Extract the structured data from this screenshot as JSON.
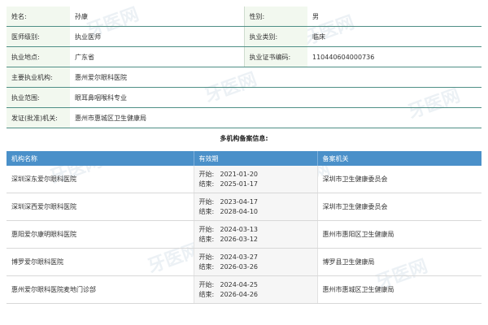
{
  "info": {
    "rows": [
      [
        {
          "label": "姓名:",
          "value": "孙康"
        },
        {
          "label": "性别:",
          "value": "男"
        }
      ],
      [
        {
          "label": "医师级别:",
          "value": "执业医师"
        },
        {
          "label": "执业类别:",
          "value": "临床"
        }
      ],
      [
        {
          "label": "执业地点:",
          "value": "广东省"
        },
        {
          "label": "执业证书编码:",
          "value": "110440604000736"
        }
      ]
    ],
    "wide_rows": [
      {
        "label": "主要执业机构:",
        "value": "惠州爱尔眼科医院"
      },
      {
        "label": "执业范围:",
        "value": "眼耳鼻咽喉科专业"
      },
      {
        "label": "发证(批准)机关:",
        "value": "惠州市惠城区卫生健康局"
      }
    ]
  },
  "section_title": "多机构备案信息:",
  "multi": {
    "headers": [
      "机构名称",
      "有效期",
      "备案机关"
    ],
    "start_label": "开始:",
    "end_label": "结束:",
    "rows": [
      {
        "name": "深圳深东爱尔眼科医院",
        "start": "2021-01-20",
        "end": "2025-01-17",
        "authority": "深圳市卫生健康委员会"
      },
      {
        "name": "深圳深西爱尔眼科医院",
        "start": "2023-04-17",
        "end": "2028-04-10",
        "authority": "深圳市卫生健康委员会"
      },
      {
        "name": "惠阳爱尔康明眼科医院",
        "start": "2024-03-13",
        "end": "2026-03-12",
        "authority": "惠州市惠阳区卫生健康局"
      },
      {
        "name": "博罗爱尔眼科医院",
        "start": "2024-03-27",
        "end": "2026-03-26",
        "authority": "博罗县卫生健康局"
      },
      {
        "name": "惠州爱尔眼科医院麦地门诊部",
        "start": "2024-04-25",
        "end": "2026-04-26",
        "authority": "惠州市惠城区卫生健康局"
      }
    ]
  },
  "watermark": "牙医网"
}
